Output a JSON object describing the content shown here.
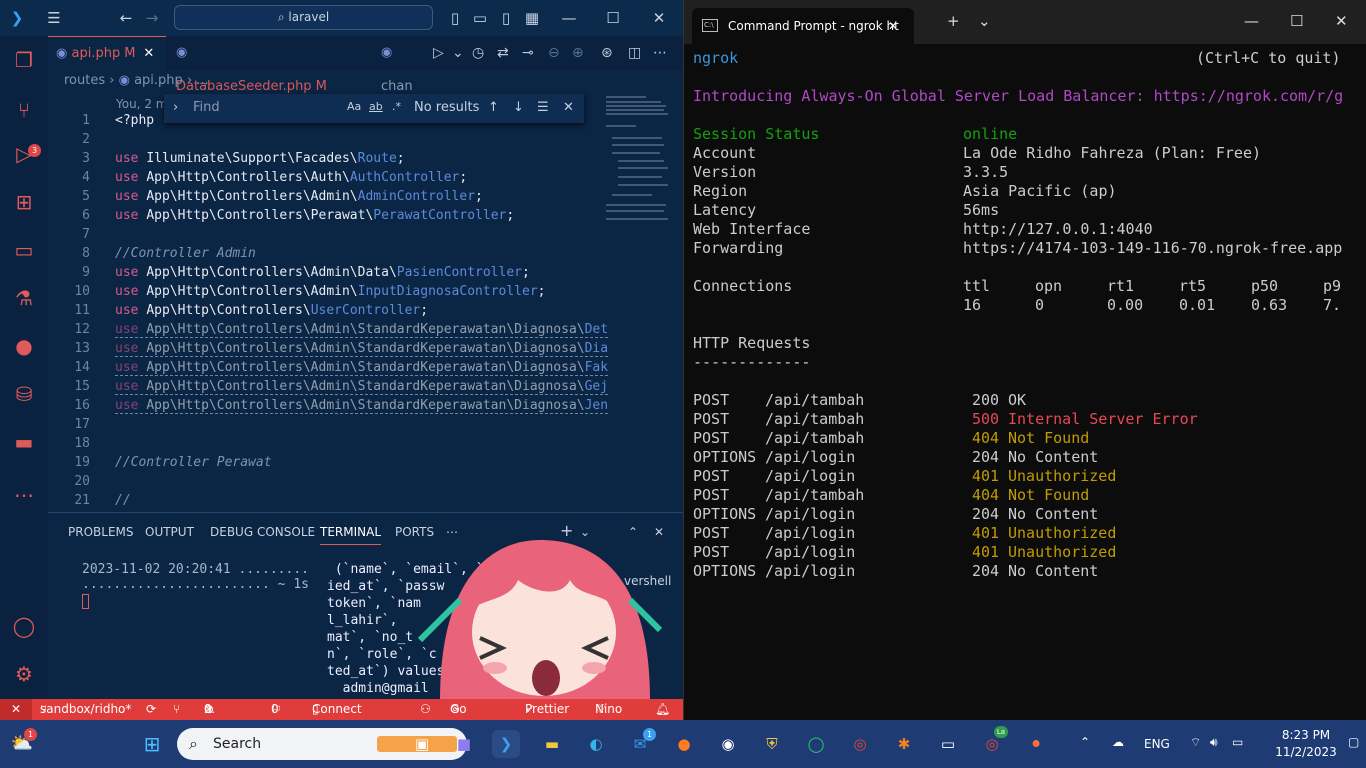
{
  "vscode": {
    "search_text": "laravel",
    "tabs": [
      {
        "label": "api.php",
        "mark": "M"
      },
      {
        "label": "DatabaseSeeder.php",
        "mark": "M"
      },
      {
        "label": "chan"
      }
    ],
    "breadcrumb": [
      "routes",
      "api.php",
      "..."
    ],
    "blame": "You, 2 mi",
    "find": {
      "placeholder": "Find",
      "case": "Aa",
      "word": "ab",
      "regex": ".*",
      "result": "No results"
    },
    "lines": [
      {
        "n": "1",
        "t": "<?php"
      },
      {
        "n": "2",
        "t": ""
      },
      {
        "n": "3",
        "pre": "use ",
        "t": "Illuminate\\Support\\Facades\\",
        "cls": "Route",
        ";": ";"
      },
      {
        "n": "4",
        "pre": "use ",
        "t": "App\\Http\\Controllers\\Auth\\",
        "cls": "AuthController"
      },
      {
        "n": "5",
        "pre": "use ",
        "t": "App\\Http\\Controllers\\Admin\\",
        "cls": "AdminController"
      },
      {
        "n": "6",
        "pre": "use ",
        "t": "App\\Http\\Controllers\\Perawat\\",
        "cls": "PerawatController"
      },
      {
        "n": "7",
        "t": ""
      },
      {
        "n": "8",
        "cm": "//Controller Admin"
      },
      {
        "n": "9",
        "pre": "use ",
        "t": "App\\Http\\Controllers\\Admin\\Data\\",
        "cls": "PasienController"
      },
      {
        "n": "10",
        "pre": "use ",
        "t": "App\\Http\\Controllers\\Admin\\",
        "cls": "InputDiagnosaController"
      },
      {
        "n": "11",
        "pre": "use ",
        "t": "App\\Http\\Controllers\\",
        "cls": "UserController"
      },
      {
        "n": "12",
        "pre": "use ",
        "t": "App\\Http\\Controllers\\Admin\\StandardKeperawatan\\Diagnosa\\",
        "cls": "Det"
      },
      {
        "n": "13",
        "pre": "use ",
        "t": "App\\Http\\Controllers\\Admin\\StandardKeperawatan\\Diagnosa\\",
        "cls": "Dia"
      },
      {
        "n": "14",
        "pre": "use ",
        "t": "App\\Http\\Controllers\\Admin\\StandardKeperawatan\\Diagnosa\\",
        "cls": "Fak"
      },
      {
        "n": "15",
        "pre": "use ",
        "t": "App\\Http\\Controllers\\Admin\\StandardKeperawatan\\Diagnosa\\",
        "cls": "Gej"
      },
      {
        "n": "16",
        "pre": "use ",
        "t": "App\\Http\\Controllers\\Admin\\StandardKeperawatan\\Diagnosa\\",
        "cls": "Jen"
      },
      {
        "n": "17",
        "t": ""
      },
      {
        "n": "18",
        "t": ""
      },
      {
        "n": "19",
        "cm": "//Controller Perawat"
      },
      {
        "n": "20",
        "t": ""
      },
      {
        "n": "21",
        "cm": "//"
      }
    ],
    "panel_tabs": [
      "PROBLEMS",
      "OUTPUT",
      "DEBUG CONSOLE",
      "TERMINAL",
      "PORTS"
    ],
    "panel_side": [
      "php",
      "vershell"
    ],
    "term_left": [
      "2023-11-02 20:20:41 .........",
      "........................ ~ 1s"
    ],
    "term_right": [
      " (`name`, `email`, `em",
      "ied_at`, `passw",
      "token`, `nam",
      "l_lahir`,",
      "mat`, `no_t",
      "n`, `role`, `c",
      "ted_at`) values",
      "  admin@gmail"
    ],
    "status": {
      "branch": "sandbox/ridho*",
      "errors": "0",
      "warnings": "0",
      "info": "0",
      "connect": "Connect",
      "golive": "Go Live",
      "prettier": "Prettier",
      "nino": "Nino"
    },
    "scm_badge": "3"
  },
  "terminal": {
    "tab_title": "Command Prompt - ngrok  ht",
    "header_left": "ngrok",
    "header_right": "(Ctrl+C to quit)",
    "banner": "Introducing Always-On Global Server Load Balancer: https://ngrok.com/r/g",
    "session": [
      {
        "k": "Session Status",
        "v": "online"
      },
      {
        "k": "Account",
        "v": "La Ode Ridho Fahreza (Plan: Free)"
      },
      {
        "k": "Version",
        "v": "3.3.5"
      },
      {
        "k": "Region",
        "v": "Asia Pacific (ap)"
      },
      {
        "k": "Latency",
        "v": "56ms"
      },
      {
        "k": "Web Interface",
        "v": "http://127.0.0.1:4040"
      },
      {
        "k": "Forwarding",
        "v": "https://4174-103-149-116-70.ngrok-free.app"
      }
    ],
    "connections_label": "Connections",
    "conn_headers": [
      "ttl",
      "opn",
      "rt1",
      "rt5",
      "p50",
      "p9"
    ],
    "conn_values": [
      "16",
      "0",
      "0.00",
      "0.01",
      "0.63",
      "7."
    ],
    "http_title": "HTTP Requests",
    "http_rule": "-------------",
    "requests": [
      {
        "method": "POST",
        "path": "/api/tambah",
        "code": "200",
        "text": "OK",
        "color": "#cccccc"
      },
      {
        "method": "POST",
        "path": "/api/tambah",
        "code": "500",
        "text": "Internal Server Error",
        "color": "#e74856"
      },
      {
        "method": "POST",
        "path": "/api/tambah",
        "code": "404",
        "text": "Not Found",
        "color": "#c19c00"
      },
      {
        "method": "OPTIONS",
        "path": "/api/login",
        "code": "204",
        "text": "No Content",
        "color": "#cccccc"
      },
      {
        "method": "POST",
        "path": "/api/login",
        "code": "401",
        "text": "Unauthorized",
        "color": "#c19c00"
      },
      {
        "method": "POST",
        "path": "/api/tambah",
        "code": "404",
        "text": "Not Found",
        "color": "#c19c00"
      },
      {
        "method": "OPTIONS",
        "path": "/api/login",
        "code": "204",
        "text": "No Content",
        "color": "#cccccc"
      },
      {
        "method": "POST",
        "path": "/api/login",
        "code": "401",
        "text": "Unauthorized",
        "color": "#c19c00"
      },
      {
        "method": "POST",
        "path": "/api/login",
        "code": "401",
        "text": "Unauthorized",
        "color": "#c19c00"
      },
      {
        "method": "OPTIONS",
        "path": "/api/login",
        "code": "204",
        "text": "No Content",
        "color": "#cccccc"
      }
    ]
  },
  "taskbar": {
    "search": "Search",
    "lang": "ENG",
    "time": "8:23 PM",
    "date": "11/2/2023",
    "weather_badge": "1",
    "mail_badge": "1",
    "chrome_badge": "La"
  }
}
